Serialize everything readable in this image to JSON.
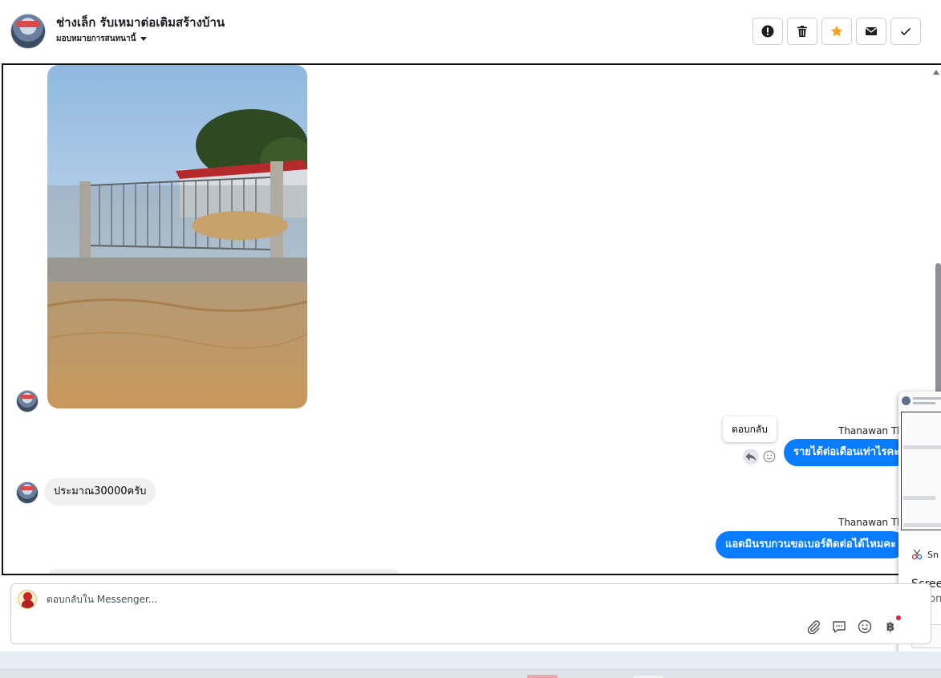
{
  "header": {
    "title": "ช่างเล็ก รับเหมาต่อเติมสร้างบ้าน",
    "subtitle": "มอบหมายการสนทนานี้",
    "buttons": [
      {
        "name": "report",
        "icon": "alert-circle-icon"
      },
      {
        "name": "delete",
        "icon": "trash-icon"
      },
      {
        "name": "star",
        "icon": "star-icon"
      },
      {
        "name": "mark-unread",
        "icon": "envelope-icon"
      },
      {
        "name": "mark-done",
        "icon": "checkmark-icon"
      }
    ]
  },
  "conversation": {
    "messages": [
      {
        "direction": "incoming",
        "type": "image",
        "icon": "house-gate-photo"
      },
      {
        "direction": "outgoing",
        "sender": "Thanawan Tho",
        "text": "รายได้ต่อเดือนเท่าไรคะ"
      },
      {
        "direction": "incoming",
        "text": "ประมาณ30000ครับ"
      },
      {
        "direction": "outgoing",
        "sender": "Thanawan Tho",
        "text": "แอดมินรบกวนขอเบอร์ติดต่อได้ไหมคะ"
      }
    ],
    "tooltip": "ตอบกลับ"
  },
  "widget": {
    "app_label": "Sn",
    "title": "Screen",
    "subtitle": "Autom"
  },
  "composer": {
    "placeholder": "ตอบกลับใน Messenger...",
    "tools": [
      "paperclip-icon",
      "saved-reply-icon",
      "emoji-icon",
      "baht-icon"
    ],
    "baht_symbol": "฿"
  },
  "colors": {
    "outgoing_bubble": "#0a7cff",
    "incoming_bubble": "#f0f0f0",
    "star": "#f5a623"
  }
}
